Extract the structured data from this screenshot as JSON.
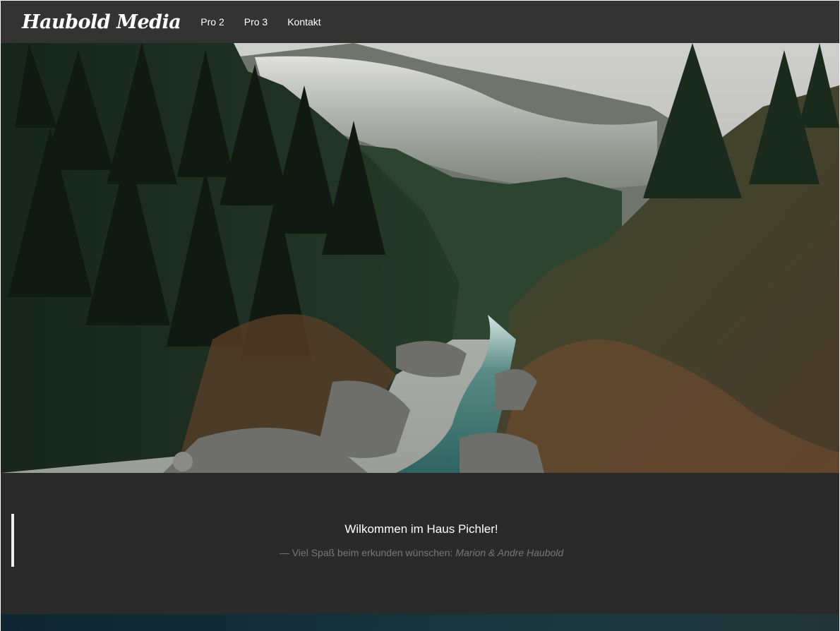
{
  "navbar": {
    "brand": "Haubold Media",
    "links": [
      {
        "label": "Pro 2"
      },
      {
        "label": "Pro 3"
      },
      {
        "label": "Kontakt"
      }
    ]
  },
  "quote": {
    "text": "Wilkommen im Haus Pichler!",
    "footer_prefix": "— Viel Spaß beim erkunden wünschen:",
    "cite": "Marion & Andre Haubold"
  },
  "colors": {
    "navbar_bg": "#333333",
    "quote_bg": "#2a2a2a",
    "quote_bar": "#eeeeee"
  }
}
